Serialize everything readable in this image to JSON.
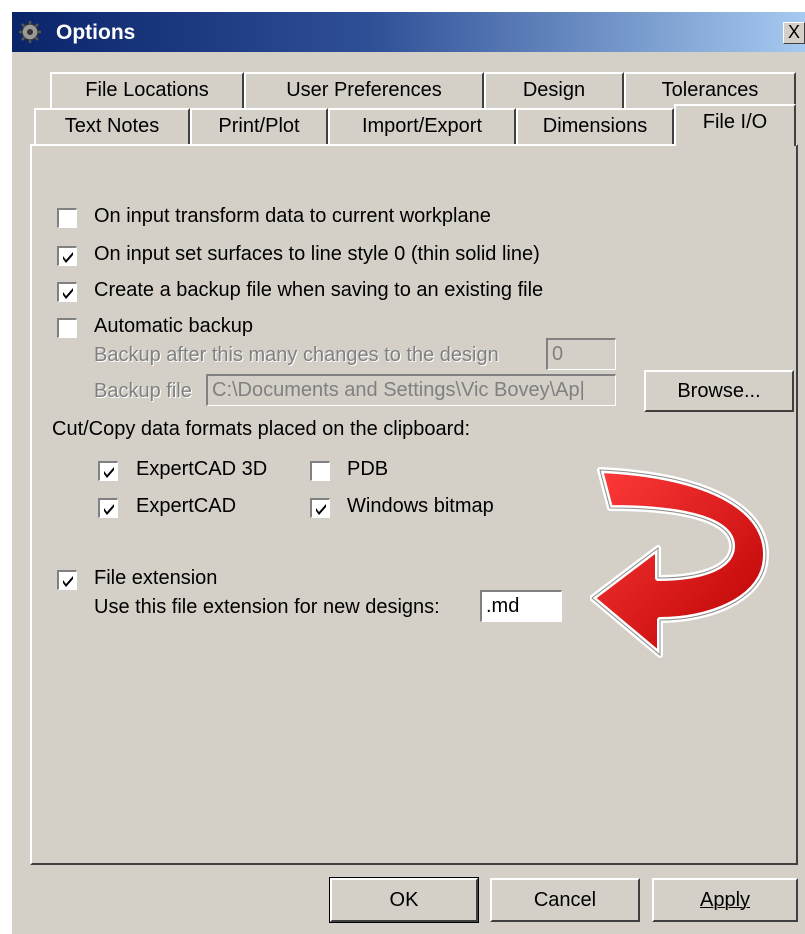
{
  "window": {
    "title": "Options",
    "close_label": "X"
  },
  "tabs_row1": [
    {
      "label": "File Locations"
    },
    {
      "label": "User Preferences"
    },
    {
      "label": "Design"
    },
    {
      "label": "Tolerances"
    }
  ],
  "tabs_row2": [
    {
      "label": "Text Notes"
    },
    {
      "label": "Print/Plot"
    },
    {
      "label": "Import/Export"
    },
    {
      "label": "Dimensions"
    },
    {
      "label": "File I/O",
      "active": true
    }
  ],
  "options": {
    "transform": {
      "label": "On input transform data to current workplane",
      "checked": false
    },
    "surfaces": {
      "label": "On input set surfaces to line style 0 (thin solid line)",
      "checked": true
    },
    "backup_file": {
      "label": "Create a backup file when saving to an existing file",
      "checked": true
    },
    "auto_backup": {
      "label": "Automatic backup",
      "checked": false
    },
    "backup_changes_label": "Backup after this many changes to the design",
    "backup_changes_value": "0",
    "backup_file_label": "Backup file",
    "backup_file_path": "C:\\Documents and Settings\\Vic Bovey\\Ap|",
    "browse_label": "Browse..."
  },
  "clipboard": {
    "heading": "Cut/Copy data formats placed on the clipboard:",
    "expertcad3d": {
      "label": "ExpertCAD 3D",
      "checked": true
    },
    "pdb": {
      "label": "PDB",
      "checked": false
    },
    "expertcad": {
      "label": "ExpertCAD",
      "checked": true
    },
    "windows_bitmap": {
      "label": "Windows bitmap",
      "checked": true
    }
  },
  "extension": {
    "label": "File extension",
    "checked": true,
    "field_label": "Use this file extension for new designs:",
    "value": ".md"
  },
  "buttons": {
    "ok": "OK",
    "cancel": "Cancel",
    "apply": "Apply"
  },
  "colors": {
    "title_bar": "#0a246a",
    "dialog_bg": "#d4d0c8",
    "arrow_red": "#e31b1b"
  }
}
